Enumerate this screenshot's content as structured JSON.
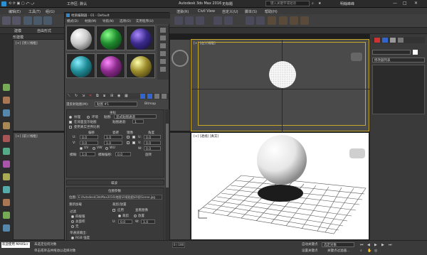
{
  "titlebar": {
    "workspace": "工作区: 默认",
    "app_title": "Autodesk 3ds Max 2016",
    "doc_title": "无标题",
    "search_placeholder": "键入关键字或短语",
    "user": "明翰峰峰"
  },
  "menubar": {
    "items": [
      "编辑(E)",
      "工具(T)",
      "组(G)",
      "视图(V)",
      "创建(C)",
      "修改器(M)",
      "动画(A)",
      "图形编辑器(D)",
      "渲染(R)",
      "Civil View",
      "自定义(U)",
      "脚本(S)",
      "帮助(H)"
    ]
  },
  "ribbon": {
    "tab1": "建模",
    "tab2": "多边形建模",
    "label": "自由形式"
  },
  "viewports": {
    "top_left_label": "[+] [顶] [线框]",
    "bottom_left_label": "[+] [前] [线框]",
    "top_right_label": "[+] [左] [线框]",
    "persp_label": "[+] [透视] [真实]"
  },
  "material_editor": {
    "title": "材质编辑器 - 01 - Default",
    "menu": [
      "模式(D)",
      "材质(M)",
      "导航(N)",
      "选项(O)",
      "实用程序(U)"
    ],
    "sphere_colors": [
      "#c8c8c8",
      "#1f8a2e",
      "#3a2a8a",
      "#1f8c96",
      "#8a2a8a",
      "#9a8a2a"
    ],
    "material_name": "贴图 #1",
    "type_label": "Bitmap",
    "tex_label": "漫反射贴图(M):",
    "coords_title": "坐标",
    "texture_opt": "纹理",
    "env_opt": "环境",
    "mapping_label": "贴图:",
    "mapping_value": "显式贴图通道",
    "show_map_back": "在背面显示贴图",
    "map_channel_label": "贴图通道:",
    "map_channel_value": "1",
    "use_real_world": "使用真实世界比例",
    "offset_label": "偏移",
    "tiling_label": "瓷砖",
    "mirror_label": "镜像",
    "angle_label": "角度",
    "u_label": "U:",
    "v_label": "V:",
    "w_label": "W:",
    "offset_u": "0.0",
    "offset_v": "0.0",
    "tiling_u": "1.0",
    "tiling_v": "1.0",
    "angle_u": "0.0",
    "angle_v": "0.0",
    "angle_w": "0.0",
    "uv": "UV",
    "vw": "VW",
    "wu": "WU",
    "blur_label": "模糊:",
    "blur_value": "1.0",
    "blur_offset_label": "模糊偏移:",
    "blur_offset_value": "0.0",
    "rotate_button": "旋转",
    "noise_title": "噪波",
    "bitmap_params_title": "位图参数",
    "bitmap_path_label": "位图:",
    "bitmap_path": "E:\\Autodesk\\3dsMax2016\\地图\\环境贴图\\环境\\Scene.jpg",
    "reload_button": "重新加载",
    "crop_title": "裁剪/放置",
    "apply": "应用",
    "view_image": "查看图像",
    "crop": "裁剪",
    "place": "放置",
    "filter_title": "过滤",
    "filter_opts": [
      "四棱锥",
      "总面积",
      "无"
    ],
    "mono_title": "单通道输出:",
    "mono_opts": [
      "RGB 强度",
      "Alpha"
    ],
    "rgb_title": "RGB 通道输出:",
    "rgb_opts": [
      "RGB",
      "Alpha 作为灰度"
    ],
    "alpha_title": "Alpha 来源",
    "alpha_opts": [
      "图像 Alpha",
      "RGB 强度",
      "无(不透明)"
    ],
    "u_val": "0.0",
    "v_val": "0.0",
    "w_val": "1.0",
    "h_val": "1.0"
  },
  "command_panel": {
    "dropdown": "修改器列表"
  },
  "statusbar": {
    "frame": "0 / 100",
    "status1": "未选定任何对象",
    "status2": "单击或单击并拖动以选择对象",
    "welcome": "欢迎使用 MAXScr",
    "autokey": "自动关键点",
    "selected": "选定对象",
    "setkey": "设置关键点",
    "keyfilter": "关键点过滤器..."
  }
}
